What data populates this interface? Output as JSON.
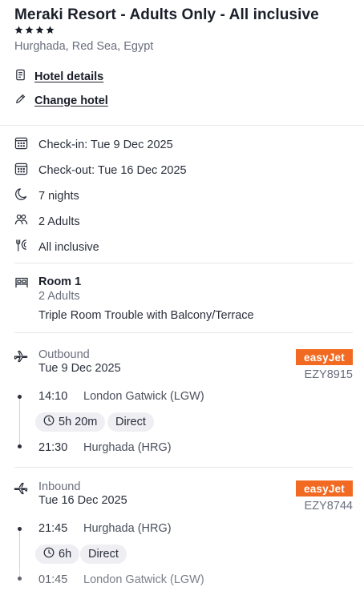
{
  "hotel": {
    "name": "Meraki Resort - Adults Only - All inclusive",
    "star_count": 4,
    "location": "Hurghada, Red Sea, Egypt",
    "details_link": "Hotel details",
    "change_link": "Change hotel"
  },
  "stay": {
    "checkin": "Check-in: Tue 9 Dec 2025",
    "checkout": "Check-out: Tue 16 Dec 2025",
    "nights": "7 nights",
    "guests": "2 Adults",
    "board": "All inclusive"
  },
  "room": {
    "title": "Room 1",
    "guests": "2 Adults",
    "type": "Triple Room Trouble with Balcony/Terrace"
  },
  "outbound": {
    "label": "Outbound",
    "date": "Tue 9 Dec 2025",
    "airline": "easyJet",
    "flight_code": "EZY8915",
    "depart_time": "14:10",
    "depart_airport": "London Gatwick (LGW)",
    "duration": "5h 20m",
    "stops": "Direct",
    "arrive_time": "21:30",
    "arrive_airport": "Hurghada (HRG)"
  },
  "inbound": {
    "label": "Inbound",
    "date": "Tue 16 Dec 2025",
    "airline": "easyJet",
    "flight_code": "EZY8744",
    "depart_time": "21:45",
    "depart_airport": "Hurghada (HRG)",
    "duration": "6h",
    "stops": "Direct",
    "arrive_time": "01:45",
    "arrive_airport": "London Gatwick (LGW)"
  },
  "colors": {
    "airline_brand": "#f26a21",
    "chip_bg": "#eeeef3",
    "text_primary": "#1b1f2a",
    "text_muted": "#6b6f7d"
  },
  "icons": {
    "stars": "star-icon",
    "details": "document-icon",
    "change": "pencil-icon",
    "checkin": "calendar-icon",
    "checkout": "calendar-icon",
    "nights": "moon-icon",
    "guests": "people-icon",
    "board": "cutlery-icon",
    "room": "bed-icon",
    "outbound": "plane-departure-icon",
    "inbound": "plane-arrival-icon",
    "duration": "clock-icon"
  }
}
